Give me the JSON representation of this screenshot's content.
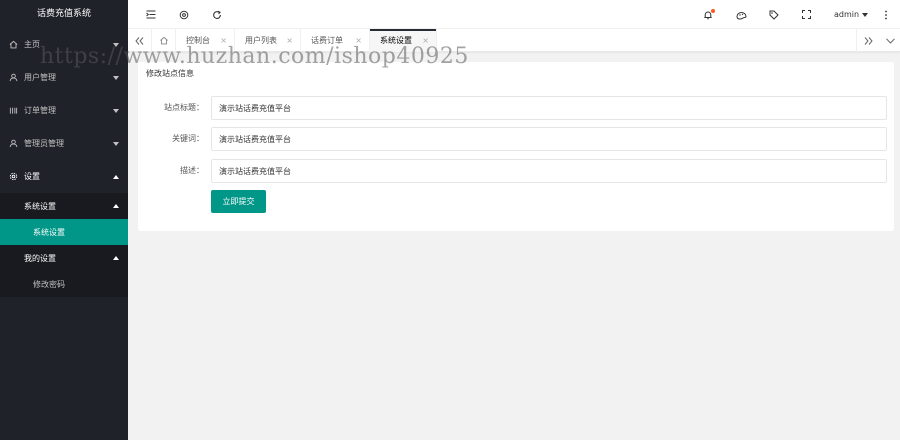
{
  "app": {
    "title": "话费充值系统"
  },
  "sidebar": {
    "items": [
      {
        "label": "主页",
        "icon": "home-icon"
      },
      {
        "label": "用户管理",
        "icon": "user-icon"
      },
      {
        "label": "订单管理",
        "icon": "order-icon"
      },
      {
        "label": "管理员管理",
        "icon": "user-icon"
      },
      {
        "label": "设置",
        "icon": "gear-icon"
      }
    ],
    "submenus": [
      {
        "label": "系统设置",
        "children": [
          "系统设置"
        ]
      },
      {
        "label": "我的设置",
        "children": [
          "修改密码"
        ]
      }
    ]
  },
  "header": {
    "user": "admin",
    "icons": [
      "menu-fold-icon",
      "globe-icon",
      "refresh-icon",
      "bell-icon",
      "theme-icon",
      "tag-icon",
      "fullscreen-icon",
      "more-icon"
    ]
  },
  "tabs": {
    "items": [
      {
        "label": "控制台"
      },
      {
        "label": "用户列表"
      },
      {
        "label": "话费订单"
      },
      {
        "label": "系统设置"
      }
    ],
    "close_symbol": "×"
  },
  "form": {
    "title": "修改站点信息",
    "fields": [
      {
        "label": "站点标题：",
        "value": "演示站话费充值平台"
      },
      {
        "label": "关键词：",
        "value": "演示站话费充值平台"
      },
      {
        "label": "描述：",
        "value": "演示站话费充值平台"
      }
    ],
    "submit_label": "立即提交"
  },
  "watermark": "https://www.huzhan.com/ishop40925",
  "colors": {
    "sidebar_bg": "#20222a",
    "accent": "#009688",
    "badge": "#ff5722"
  }
}
